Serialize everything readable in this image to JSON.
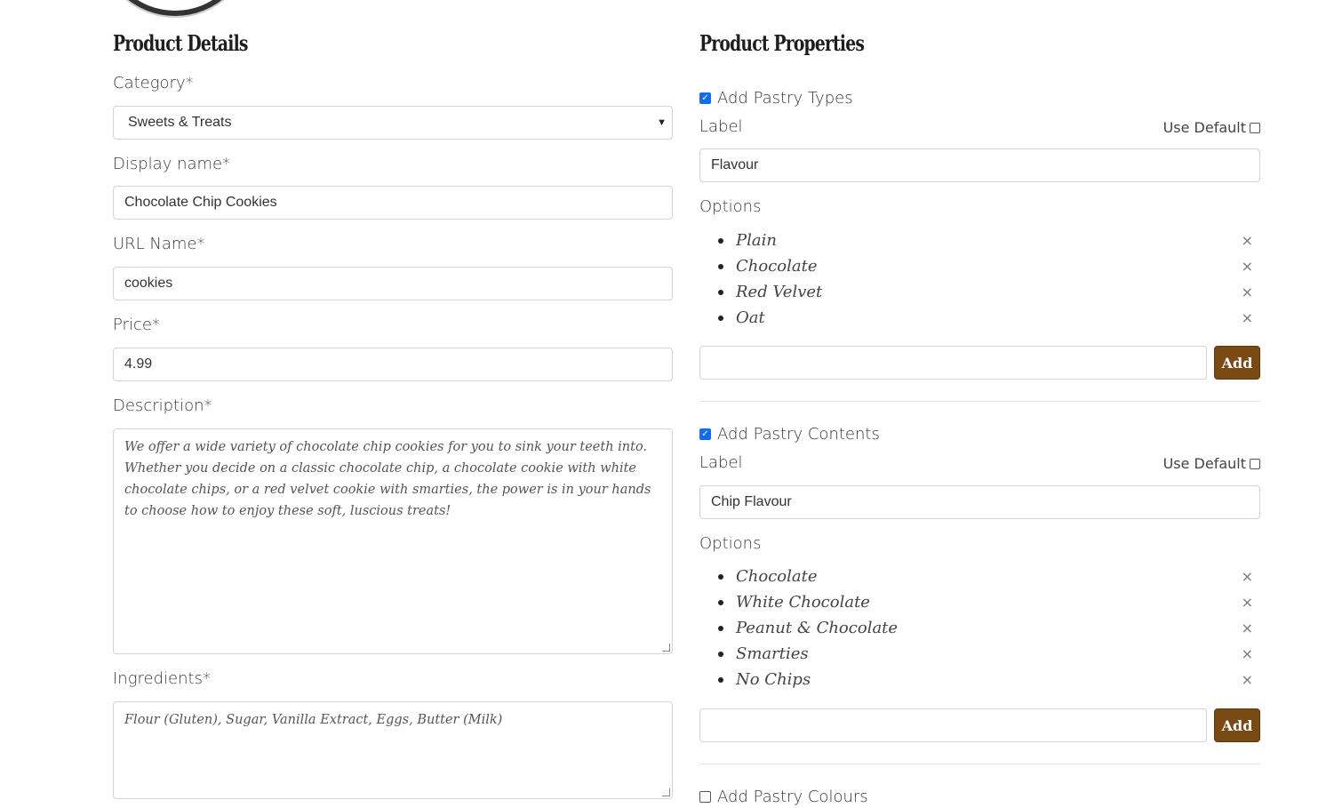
{
  "details": {
    "title": "Product Details",
    "category_label": "Category*",
    "category_value": "Sweets & Treats",
    "display_name_label": "Display name*",
    "display_name_value": "Chocolate Chip Cookies",
    "url_name_label": "URL Name*",
    "url_name_value": "cookies",
    "price_label": "Price*",
    "price_value": "4.99",
    "description_label": "Description*",
    "description_value": "We offer a wide variety of chocolate chip cookies for you to sink your teeth into. Whether you decide on a classic chocolate chip, a chocolate cookie with white chocolate chips, or a red velvet cookie with smarties, the power is in your hands to choose how to enjoy these soft, luscious treats!",
    "ingredients_label": "Ingredients*",
    "ingredients_value": "Flour (Gluten), Sugar, Vanilla Extract, Eggs, Butter (Milk)"
  },
  "properties": {
    "title": "Product Properties",
    "types": {
      "checkbox_label": "Add Pastry Types",
      "checked": true,
      "label_caption": "Label",
      "use_default": "Use Default",
      "label_value": "Flavour",
      "options_caption": "Options",
      "options": [
        "Plain",
        "Chocolate",
        "Red Velvet",
        "Oat"
      ],
      "add_button": "Add"
    },
    "contents": {
      "checkbox_label": "Add Pastry Contents",
      "checked": true,
      "label_caption": "Label",
      "use_default": "Use Default",
      "label_value": "Chip Flavour",
      "options_caption": "Options",
      "options": [
        "Chocolate",
        "White Chocolate",
        "Peanut & Chocolate",
        "Smarties",
        "No Chips"
      ],
      "add_button": "Add"
    },
    "colours": {
      "checkbox_label": "Add Pastry Colours",
      "checked": false
    }
  },
  "icons": {
    "remove": "×",
    "chevron": "⌄"
  }
}
